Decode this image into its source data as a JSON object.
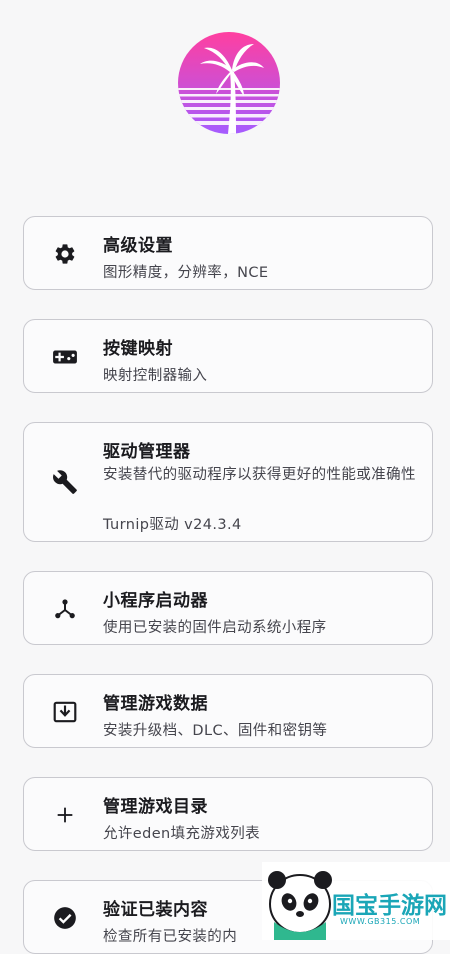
{
  "menu": [
    {
      "title": "高级设置",
      "subtitle": "图形精度，分辨率，NCE",
      "icon": "gear-icon"
    },
    {
      "title": "按键映射",
      "subtitle": "映射控制器输入",
      "icon": "gamepad-icon"
    },
    {
      "title": "驱动管理器",
      "subtitle": "安装替代的驱动程序以获得更好的性能或准确性",
      "detail": "Turnip驱动  v24.3.4",
      "icon": "wrench-icon"
    },
    {
      "title": "小程序启动器",
      "subtitle": "使用已安装的固件启动系统小程序",
      "icon": "applet-icon"
    },
    {
      "title": "管理游戏数据",
      "subtitle": "安装升级档、DLC、固件和密钥等",
      "icon": "install-icon"
    },
    {
      "title": "管理游戏目录",
      "subtitle": "允许eden填充游戏列表",
      "icon": "plus-icon"
    },
    {
      "title": "验证已装内容",
      "subtitle": "检查所有已安装的内",
      "icon": "check-circle-icon"
    }
  ],
  "watermark": {
    "text": "国宝手游网",
    "url": "WWW.GB315.COM"
  },
  "colors": {
    "logo_top": "#ff4fa3",
    "logo_bottom": "#a65bff",
    "accent": "#1aa6b7"
  }
}
